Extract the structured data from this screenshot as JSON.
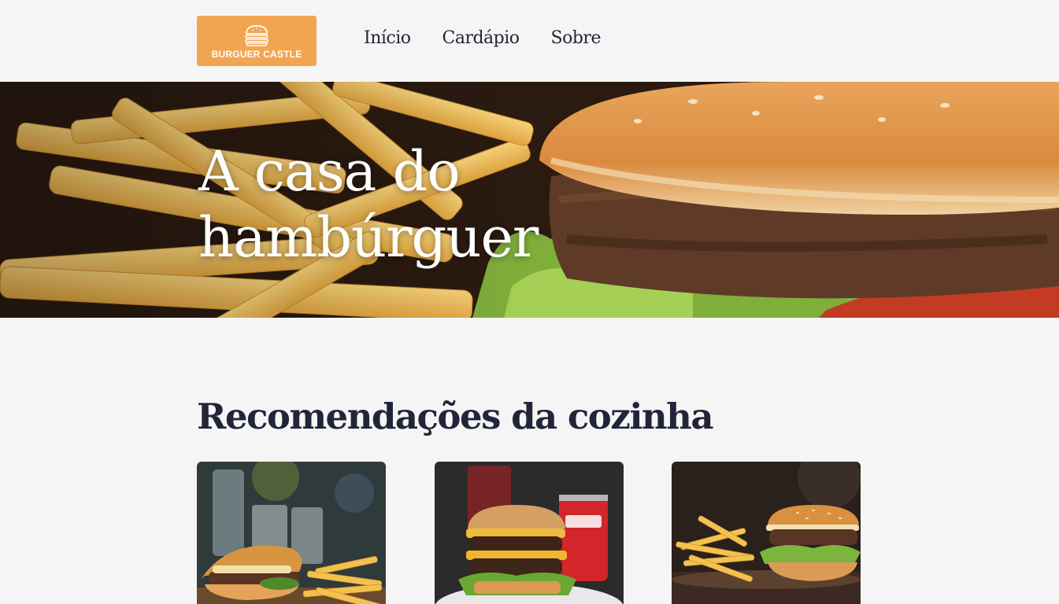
{
  "header": {
    "logo_text": "BURGUER CASTLE",
    "logo_icon": "burger-icon",
    "nav": [
      {
        "label": "Início"
      },
      {
        "label": "Cardápio"
      },
      {
        "label": "Sobre"
      }
    ]
  },
  "hero": {
    "title": "A casa do hambúrguer"
  },
  "recommendations": {
    "title": "Recomendações da cozinha",
    "cards": [
      {
        "image": "burger-with-fries-and-drinks-photo"
      },
      {
        "image": "double-cheeseburger-with-cola-photo"
      },
      {
        "image": "burger-with-fries-on-board-photo"
      }
    ]
  },
  "colors": {
    "accent": "#f2a551",
    "background": "#f5f5f5",
    "text": "#22253a"
  }
}
